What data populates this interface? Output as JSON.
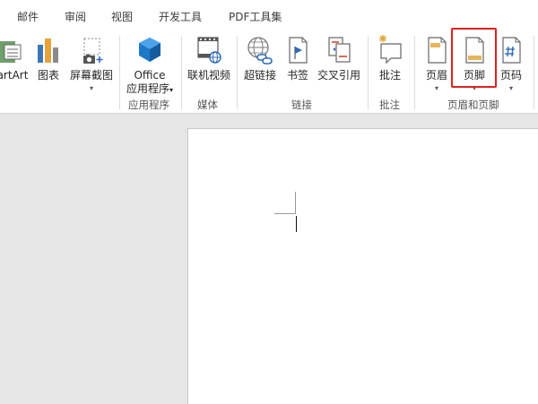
{
  "tabs": [
    {
      "label": "邮件"
    },
    {
      "label": "审阅"
    },
    {
      "label": "视图"
    },
    {
      "label": "开发工具"
    },
    {
      "label": "PDF工具集"
    }
  ],
  "ribbon": {
    "smartart_label": "artArt",
    "chart_label": "图表",
    "screenshot_label": "屏幕截图",
    "office_apps_line1": "Office",
    "office_apps_line2": "应用程序",
    "online_video_label": "联机视频",
    "hyperlink_label": "超链接",
    "bookmark_label": "书签",
    "cross_reference_label": "交叉引用",
    "comment_label": "批注",
    "header_label": "页眉",
    "footer_label": "页脚",
    "page_number_label": "页码",
    "dropdown_glyph": "▾",
    "groups": {
      "apps": "应用程序",
      "media": "媒体",
      "links": "链接",
      "comments": "批注",
      "header_footer": "页眉和页脚"
    }
  },
  "colors": {
    "highlight_border": "#e02020",
    "office_icon_blue": "#1e78c8",
    "ribbon_background": "#ffffff",
    "workspace_background": "#e6e6e6"
  },
  "icons": {
    "smartart": "smartart-icon",
    "chart": "bar-chart-icon",
    "screenshot": "screenshot-icon",
    "office_apps": "office-store-icon",
    "online_video": "film-globe-icon",
    "hyperlink": "globe-link-icon",
    "bookmark": "bookmark-flag-icon",
    "cross_reference": "cross-reference-icon",
    "comment": "comment-icon",
    "header": "header-page-icon",
    "footer": "footer-page-icon",
    "page_number": "page-number-icon"
  }
}
